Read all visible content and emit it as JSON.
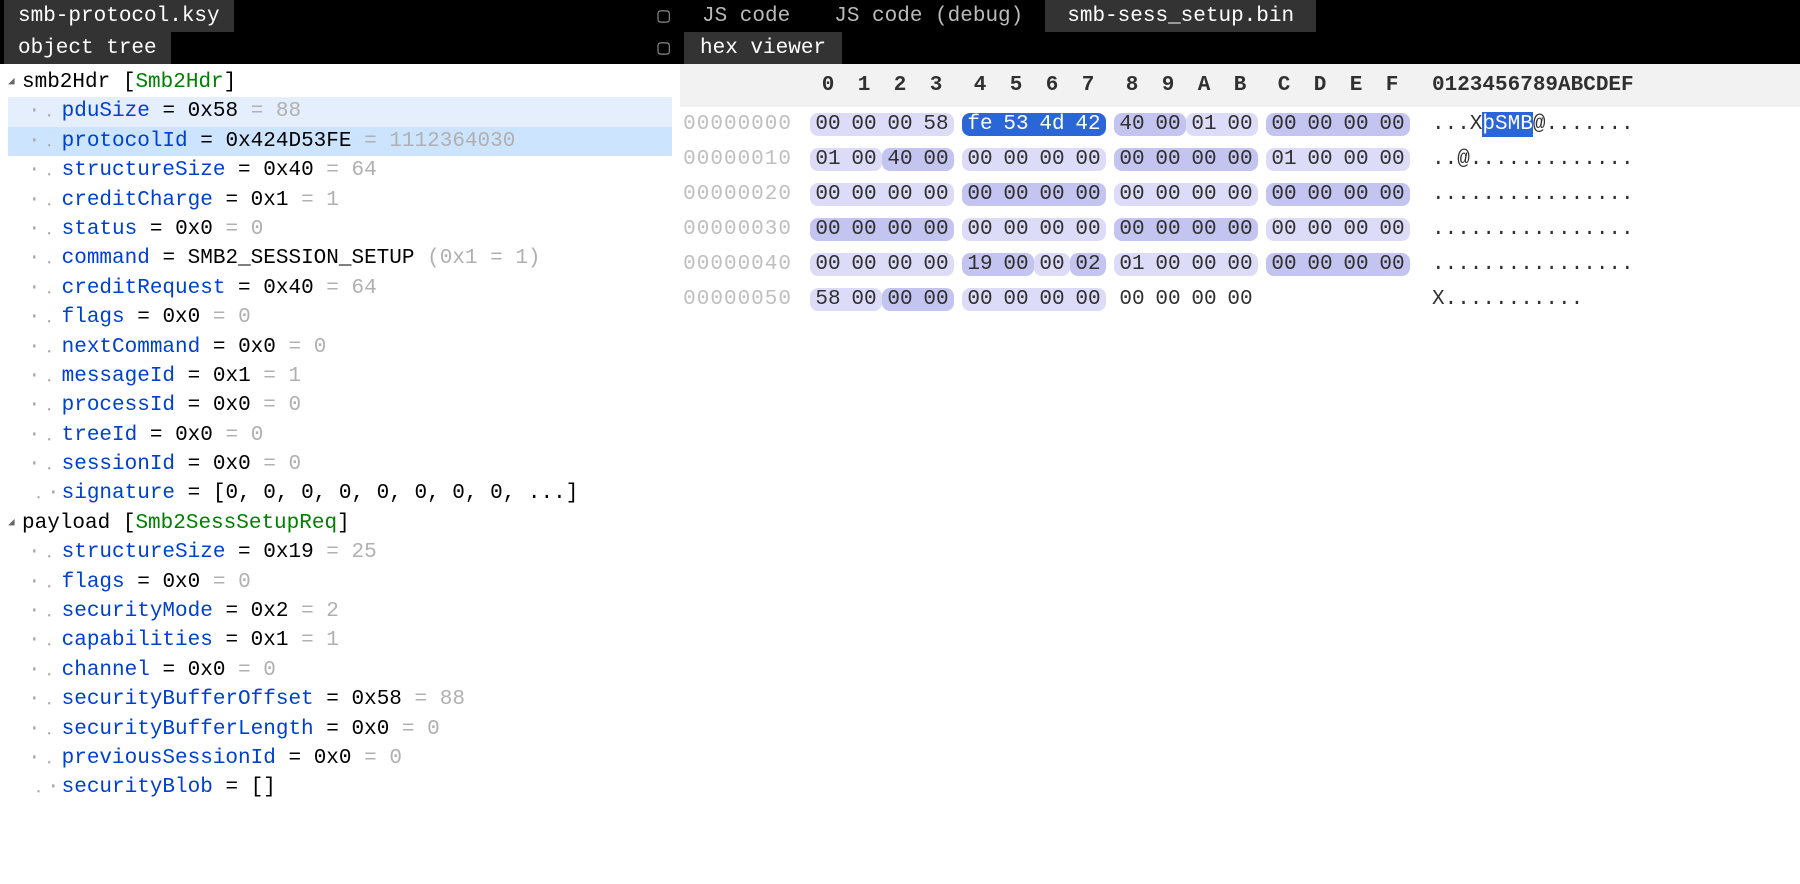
{
  "left": {
    "file_tab": "smb-protocol.ksy",
    "tree_tab": "object tree",
    "nodes": [
      {
        "depth": 0,
        "exp": "▾",
        "name": "smb2Hdr",
        "type": "Smb2Hdr"
      },
      {
        "depth": 1,
        "name": "pduSize",
        "hex": "0x58",
        "dec": "88",
        "hl": true
      },
      {
        "depth": 1,
        "name": "protocolId",
        "hex": "0x424D53FE",
        "dec": "1112364030",
        "sel": true
      },
      {
        "depth": 1,
        "name": "structureSize",
        "hex": "0x40",
        "dec": "64"
      },
      {
        "depth": 1,
        "name": "creditCharge",
        "hex": "0x1",
        "dec": "1"
      },
      {
        "depth": 1,
        "name": "status",
        "hex": "0x0",
        "dec": "0"
      },
      {
        "depth": 1,
        "name": "command",
        "rawval": "SMB2_SESSION_SETUP",
        "paren": "(0x1 = 1)"
      },
      {
        "depth": 1,
        "name": "creditRequest",
        "hex": "0x40",
        "dec": "64"
      },
      {
        "depth": 1,
        "name": "flags",
        "hex": "0x0",
        "dec": "0"
      },
      {
        "depth": 1,
        "name": "nextCommand",
        "hex": "0x0",
        "dec": "0"
      },
      {
        "depth": 1,
        "name": "messageId",
        "hex": "0x1",
        "dec": "1"
      },
      {
        "depth": 1,
        "name": "processId",
        "hex": "0x0",
        "dec": "0"
      },
      {
        "depth": 1,
        "name": "treeId",
        "hex": "0x0",
        "dec": "0"
      },
      {
        "depth": 1,
        "name": "sessionId",
        "hex": "0x0",
        "dec": "0"
      },
      {
        "depth": 1,
        "name": "signature",
        "rawval": "[0, 0, 0, 0, 0, 0, 0, 0, ...]",
        "last": true
      },
      {
        "depth": 0,
        "exp": "▾",
        "name": "payload",
        "type": "Smb2SessSetupReq"
      },
      {
        "depth": 1,
        "name": "structureSize",
        "hex": "0x19",
        "dec": "25"
      },
      {
        "depth": 1,
        "name": "flags",
        "hex": "0x0",
        "dec": "0"
      },
      {
        "depth": 1,
        "name": "securityMode",
        "hex": "0x2",
        "dec": "2"
      },
      {
        "depth": 1,
        "name": "capabilities",
        "hex": "0x1",
        "dec": "1"
      },
      {
        "depth": 1,
        "name": "channel",
        "hex": "0x0",
        "dec": "0"
      },
      {
        "depth": 1,
        "name": "securityBufferOffset",
        "hex": "0x58",
        "dec": "88"
      },
      {
        "depth": 1,
        "name": "securityBufferLength",
        "hex": "0x0",
        "dec": "0"
      },
      {
        "depth": 1,
        "name": "previousSessionId",
        "hex": "0x0",
        "dec": "0"
      },
      {
        "depth": 1,
        "name": "securityBlob",
        "rawval": "[]",
        "last": true
      }
    ]
  },
  "right": {
    "tabs": [
      "JS code",
      "JS code (debug)",
      "smb-sess_setup.bin"
    ],
    "active_tab": 2,
    "viewer_tab": "hex viewer",
    "col_labels": [
      "0",
      "1",
      "2",
      "3",
      "4",
      "5",
      "6",
      "7",
      "8",
      "9",
      "A",
      "B",
      "C",
      "D",
      "E",
      "F"
    ],
    "ascii_header": "0123456789ABCDEF",
    "rows": [
      {
        "addr": "00000000",
        "b": [
          "00",
          "00",
          "00",
          "58",
          "fe",
          "53",
          "4d",
          "42",
          "40",
          "00",
          "01",
          "00",
          "00",
          "00",
          "00",
          "00"
        ],
        "ascii_pre": "...X",
        "ascii_sel": "þSMB",
        "ascii_post": "@.......",
        "cls": [
          "bg1",
          "bg1",
          "bg1",
          "bg1",
          "bgsel",
          "bgsel",
          "bgsel",
          "bgsel",
          "bg2",
          "bg2",
          "bg1",
          "bg1",
          "bg2",
          "bg2",
          "bg2",
          "bg2"
        ]
      },
      {
        "addr": "00000010",
        "b": [
          "01",
          "00",
          "40",
          "00",
          "00",
          "00",
          "00",
          "00",
          "00",
          "00",
          "00",
          "00",
          "01",
          "00",
          "00",
          "00"
        ],
        "ascii_pre": "..@.............",
        "ascii_sel": "",
        "ascii_post": "",
        "cls": [
          "bg1",
          "bg1",
          "bg2",
          "bg2",
          "bg1",
          "bg1",
          "bg1",
          "bg1",
          "bg2",
          "bg2",
          "bg2",
          "bg2",
          "bg1",
          "bg1",
          "bg1",
          "bg1"
        ]
      },
      {
        "addr": "00000020",
        "b": [
          "00",
          "00",
          "00",
          "00",
          "00",
          "00",
          "00",
          "00",
          "00",
          "00",
          "00",
          "00",
          "00",
          "00",
          "00",
          "00"
        ],
        "ascii_pre": "................",
        "ascii_sel": "",
        "ascii_post": "",
        "cls": [
          "bg1",
          "bg1",
          "bg1",
          "bg1",
          "bg2",
          "bg2",
          "bg2",
          "bg2",
          "bg1",
          "bg1",
          "bg1",
          "bg1",
          "bg2",
          "bg2",
          "bg2",
          "bg2"
        ]
      },
      {
        "addr": "00000030",
        "b": [
          "00",
          "00",
          "00",
          "00",
          "00",
          "00",
          "00",
          "00",
          "00",
          "00",
          "00",
          "00",
          "00",
          "00",
          "00",
          "00"
        ],
        "ascii_pre": "................",
        "ascii_sel": "",
        "ascii_post": "",
        "cls": [
          "bg2",
          "bg2",
          "bg2",
          "bg2",
          "bg1",
          "bg1",
          "bg1",
          "bg1",
          "bg2",
          "bg2",
          "bg2",
          "bg2",
          "bg1",
          "bg1",
          "bg1",
          "bg1"
        ]
      },
      {
        "addr": "00000040",
        "b": [
          "00",
          "00",
          "00",
          "00",
          "19",
          "00",
          "00",
          "02",
          "01",
          "00",
          "00",
          "00",
          "00",
          "00",
          "00",
          "00"
        ],
        "ascii_pre": "................",
        "ascii_sel": "",
        "ascii_post": "",
        "cls": [
          "bg1",
          "bg1",
          "bg1",
          "bg1",
          "bg2",
          "bg2",
          "bg1",
          "bg2",
          "bg1",
          "bg1",
          "bg1",
          "bg1",
          "bg2",
          "bg2",
          "bg2",
          "bg2"
        ]
      },
      {
        "addr": "00000050",
        "b": [
          "58",
          "00",
          "00",
          "00",
          "00",
          "00",
          "00",
          "00",
          "00",
          "00",
          "00",
          "00",
          "",
          "",
          "",
          ""
        ],
        "ascii_pre": "X...........",
        "ascii_sel": "",
        "ascii_post": "",
        "cls": [
          "bg1",
          "bg1",
          "bg2",
          "bg2",
          "bg1",
          "bg1",
          "bg1",
          "bg1",
          "",
          "",
          "",
          "",
          "",
          "",
          "",
          ""
        ]
      }
    ]
  }
}
